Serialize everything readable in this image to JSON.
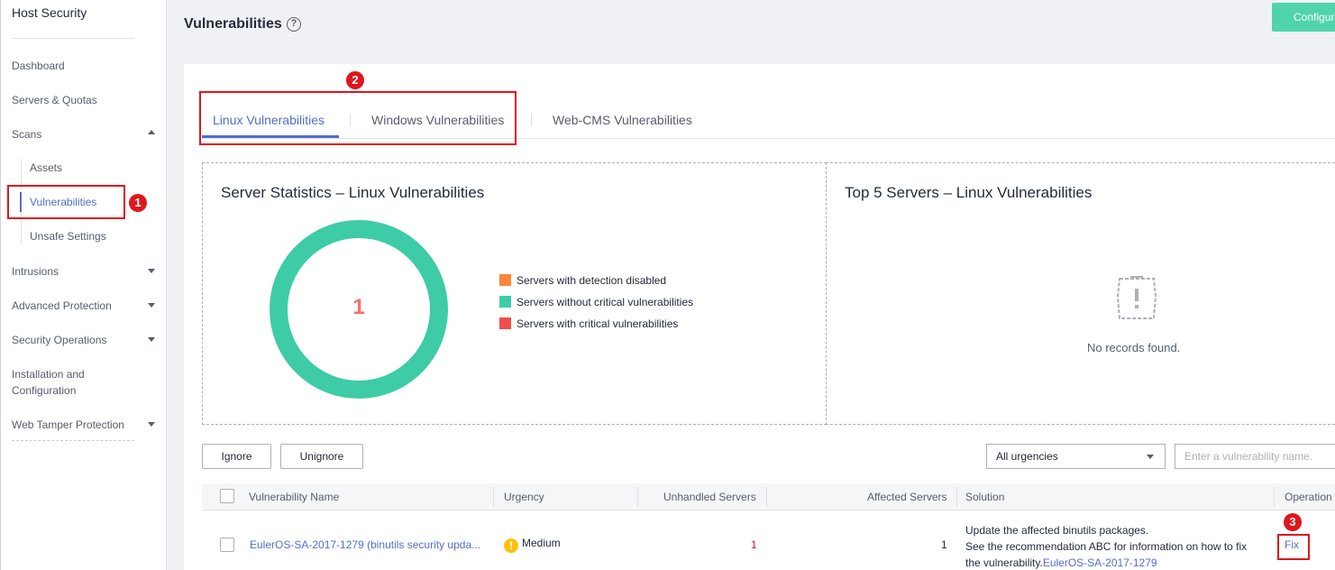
{
  "sidebar": {
    "title": "Host Security",
    "items": [
      {
        "label": "Dashboard"
      },
      {
        "label": "Servers & Quotas"
      },
      {
        "label": "Scans"
      },
      {
        "label": "Intrusions"
      },
      {
        "label": "Advanced Protection"
      },
      {
        "label": "Security Operations"
      },
      {
        "label": "Installation and Configuration"
      },
      {
        "label": "Web Tamper Protection"
      }
    ],
    "scans_sub": [
      {
        "label": "Assets"
      },
      {
        "label": "Vulnerabilities"
      },
      {
        "label": "Unsafe Settings"
      }
    ]
  },
  "header": {
    "title": "Vulnerabilities",
    "help_icon": "?",
    "config_button": "Configure"
  },
  "tabs": [
    {
      "label": "Linux Vulnerabilities"
    },
    {
      "label": "Windows Vulnerabilities"
    },
    {
      "label": "Web-CMS Vulnerabilities"
    }
  ],
  "stats": {
    "title": "Server Statistics – Linux Vulnerabilities",
    "total": "1",
    "legend": [
      {
        "label": "Servers with detection disabled",
        "color": "#fa8737"
      },
      {
        "label": "Servers without critical vulnerabilities",
        "color": "#3dcca6"
      },
      {
        "label": "Servers with critical vulnerabilities",
        "color": "#f24d4d"
      }
    ]
  },
  "top5": {
    "title": "Top 5 Servers – Linux Vulnerabilities",
    "empty_text": "No records found."
  },
  "toolbar": {
    "ignore": "Ignore",
    "unignore": "Unignore",
    "urgency_select": "All urgencies",
    "search_placeholder": "Enter a vulnerability name."
  },
  "table": {
    "columns": [
      "Vulnerability Name",
      "Urgency",
      "Unhandled Servers",
      "Affected Servers",
      "Solution",
      "Operation"
    ],
    "rows": [
      {
        "name": "EulerOS-SA-2017-1279 (binutils security upda...",
        "urgency": "Medium",
        "unhandled": "1",
        "affected": "1",
        "solution_line1": "Update the affected binutils packages.",
        "solution_line2": "See the recommendation ABC for information on how to fix",
        "solution_line3_text": "the vulnerability.",
        "solution_link": "EulerOS-SA-2017-1279",
        "operation": "Fix"
      }
    ]
  },
  "callouts": [
    "1",
    "2",
    "3"
  ],
  "colors": {
    "accent": "#526ecc",
    "highlight_red": "#e0161d",
    "donut": "#3dcca6",
    "config_green": "#50d4ab"
  }
}
